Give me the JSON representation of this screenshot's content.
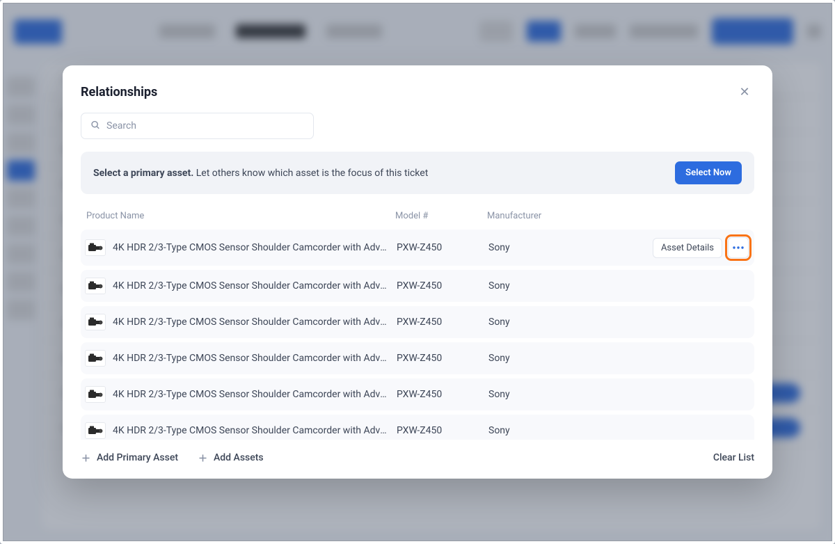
{
  "modal": {
    "title": "Relationships",
    "search_placeholder": "Search",
    "notice_strong": "Select a primary asset.",
    "notice_rest": " Let others know which asset is the focus of this ticket",
    "select_now_label": "Select Now",
    "headers": {
      "product": "Product Name",
      "model": "Model #",
      "manufacturer": "Manufacturer"
    },
    "rows": [
      {
        "product": "4K HDR 2/3-Type CMOS Sensor Shoulder Camcorder with Advance…",
        "model": "PXW-Z450",
        "manufacturer": "Sony",
        "showActions": true
      },
      {
        "product": "4K HDR 2/3-Type CMOS Sensor Shoulder Camcorder with Advance…",
        "model": "PXW-Z450",
        "manufacturer": "Sony",
        "showActions": false
      },
      {
        "product": "4K HDR 2/3-Type CMOS Sensor Shoulder Camcorder with Advance…",
        "model": "PXW-Z450",
        "manufacturer": "Sony",
        "showActions": false
      },
      {
        "product": "4K HDR 2/3-Type CMOS Sensor Shoulder Camcorder with Advance…",
        "model": "PXW-Z450",
        "manufacturer": "Sony",
        "showActions": false
      },
      {
        "product": "4K HDR 2/3-Type CMOS Sensor Shoulder Camcorder with Advance…",
        "model": "PXW-Z450",
        "manufacturer": "Sony",
        "showActions": false
      },
      {
        "product": "4K HDR 2/3-Type CMOS Sensor Shoulder Camcorder with Advance…",
        "model": "PXW-Z450",
        "manufacturer": "Sony",
        "showActions": false
      }
    ],
    "asset_details_label": "Asset Details",
    "footer": {
      "add_primary": "Add Primary Asset",
      "add_assets": "Add Assets",
      "clear": "Clear List"
    }
  }
}
